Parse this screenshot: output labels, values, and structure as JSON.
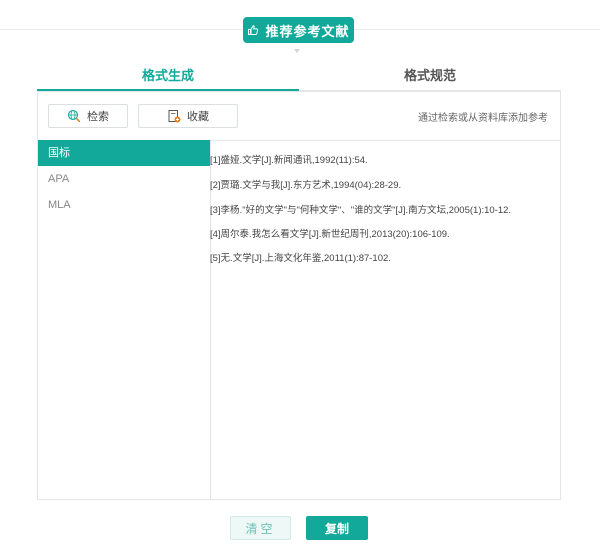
{
  "header": {
    "recommend_label": "推荐参考文献"
  },
  "tabs": [
    {
      "label": "格式生成",
      "active": true
    },
    {
      "label": "格式规范",
      "active": false
    }
  ],
  "toolbar": {
    "search_label": "检索",
    "favorites_label": "收藏",
    "hint": "通过检索或从资料库添加参考"
  },
  "sidebar": {
    "items": [
      {
        "label": "国标",
        "active": true
      },
      {
        "label": "APA",
        "active": false
      },
      {
        "label": "MLA",
        "active": false
      }
    ]
  },
  "references": [
    "[1]盛娅.文学[J].新闻通讯,1992(11):54.",
    "[2]贾璐.文学与我[J].东方艺术,1994(04):28-29.",
    "[3]李杨.\"好的文学\"与\"何种文学\"、\"谁的文学\"[J].南方文坛,2005(1):10-12.",
    "[4]周尔泰.我怎么看文学[J].新世纪周刊,2013(20):106-109.",
    "[5]无.文学[J].上海文化年鉴,2011(1):87-102."
  ],
  "actions": {
    "clear_label": "清空",
    "copy_label": "复制"
  },
  "colors": {
    "accent": "#12a99a"
  },
  "icons": {
    "recommend": "thumbs-up-icon",
    "search": "globe-search-icon",
    "favorites": "bookmark-add-icon",
    "arrow": "caret-down-icon"
  }
}
